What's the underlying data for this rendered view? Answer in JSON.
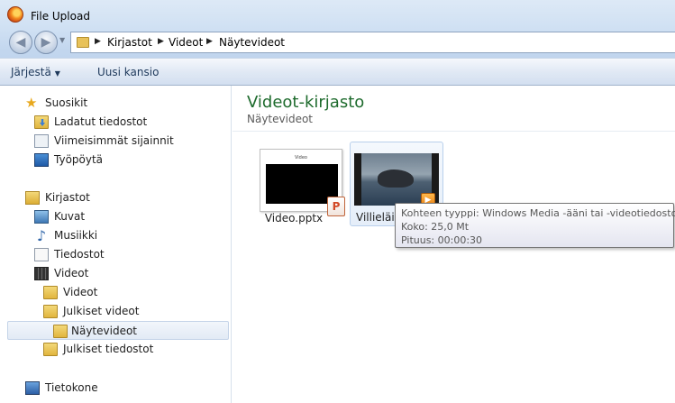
{
  "window": {
    "title": "File Upload"
  },
  "address": {
    "crumbs": [
      "Kirjastot",
      "Videot",
      "Näytevideot"
    ]
  },
  "toolbar": {
    "organize_label": "Järjestä",
    "new_folder_label": "Uusi kansio"
  },
  "navpane": {
    "favorites": {
      "label": "Suosikit",
      "items": [
        "Ladatut tiedostot",
        "Viimeisimmät sijainnit",
        "Työpöytä"
      ]
    },
    "libraries": {
      "label": "Kirjastot",
      "items": [
        "Kuvat",
        "Musiikki",
        "Tiedostot",
        "Videot"
      ],
      "video_children": [
        "Videot",
        "Julkiset videot",
        "Näytevideot",
        "Julkiset tiedostot"
      ]
    },
    "computer": {
      "label": "Tietokone"
    }
  },
  "content": {
    "title": "Videot-kirjasto",
    "subtitle": "Näytevideot",
    "files": [
      {
        "name": "Video.pptx",
        "thumb_title": "Video",
        "badge": "P"
      },
      {
        "name": "Villieläin"
      }
    ]
  },
  "tooltip": {
    "type_line": "Kohteen tyyppi: Windows Media -ääni tai -videotiedosto",
    "size_line": "Koko: 25,0 Mt",
    "length_line": "Pituus: 00:00:30"
  }
}
